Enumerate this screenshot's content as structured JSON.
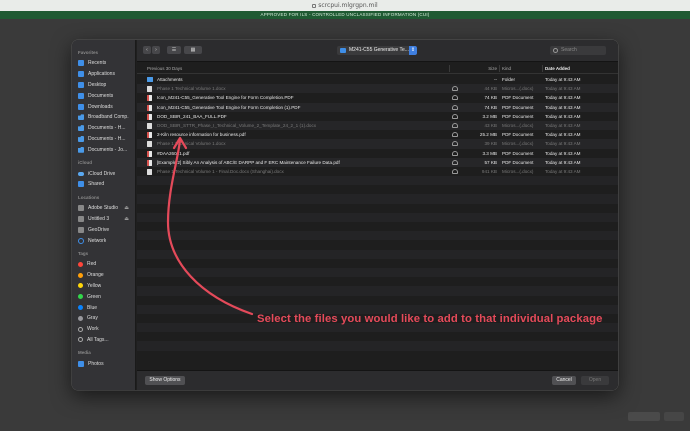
{
  "browser": {
    "url": "scrcpui.mlgrgpn.mil",
    "banner": "APPROVED FOR ILS - CONTROLLED UNCLASSIFIED INFORMATION (CUI)"
  },
  "sidebar": {
    "favorites_heading": "Favorites",
    "favorites": [
      {
        "label": "Recents",
        "icon": "clock-icon"
      },
      {
        "label": "Applications",
        "icon": "applications-icon"
      },
      {
        "label": "Desktop",
        "icon": "desktop-icon"
      },
      {
        "label": "Documents",
        "icon": "documents-icon"
      },
      {
        "label": "Downloads",
        "icon": "downloads-icon"
      },
      {
        "label": "Broadband Comp...",
        "icon": "folder-icon"
      },
      {
        "label": "Documents - H...",
        "icon": "folder-icon"
      },
      {
        "label": "Documents - H...",
        "icon": "folder-icon"
      },
      {
        "label": "Documents - Jo...",
        "icon": "folder-icon"
      }
    ],
    "icloud_heading": "iCloud",
    "icloud": [
      {
        "label": "iCloud Drive",
        "icon": "cloud-icon"
      },
      {
        "label": "Shared",
        "icon": "shared-icon"
      }
    ],
    "locations_heading": "Locations",
    "locations": [
      {
        "label": "Adobe Studio",
        "icon": "disk-icon"
      },
      {
        "label": "Untitled 3",
        "icon": "disk-icon"
      },
      {
        "label": "GeoDrive",
        "icon": "disk-icon"
      },
      {
        "label": "Network",
        "icon": "globe-icon"
      }
    ],
    "tags_heading": "Tags",
    "tags": [
      {
        "label": "Red",
        "color": "#ff453a"
      },
      {
        "label": "Orange",
        "color": "#ff9f0a"
      },
      {
        "label": "Yellow",
        "color": "#ffd60a"
      },
      {
        "label": "Green",
        "color": "#32d74b"
      },
      {
        "label": "Blue",
        "color": "#0a84ff"
      },
      {
        "label": "Gray",
        "color": "#98989d"
      },
      {
        "label": "Work",
        "color": ""
      },
      {
        "label": "All Tags...",
        "color": ""
      }
    ],
    "media_heading": "Media",
    "media": [
      {
        "label": "Photos",
        "icon": "photos-icon"
      }
    ]
  },
  "toolbar": {
    "back": "‹",
    "forward": "›",
    "view": "☰",
    "group": "▦",
    "location": "M241-C55 Generative Te...",
    "search_placeholder": "Search"
  },
  "columns": {
    "section": "Previous 30 Days",
    "size": "Size",
    "kind": "Kind",
    "date": "Date Added"
  },
  "files": [
    {
      "name": "Attachments",
      "type": "folder",
      "size": "--",
      "kind": "Folder",
      "date": "Today at 9:43 AM",
      "dim": false
    },
    {
      "name": "Phase 1 Technical Volume 1.docx",
      "type": "doc",
      "size": "44 KB",
      "kind": "Micros...(.docx)",
      "date": "Today at 9:43 AM",
      "dim": true
    },
    {
      "name": "Icon_M241-C55_Generative Tool Engine for Form Completion.PDF",
      "type": "pdf",
      "size": "74 KB",
      "kind": "PDF Document",
      "date": "Today at 9:43 AM",
      "dim": false
    },
    {
      "name": "Icon_M241-C55_Generative Tool Engine for Form Completion (1).PDF",
      "type": "pdf",
      "size": "74 KB",
      "kind": "PDF Document",
      "date": "Today at 9:43 AM",
      "dim": false
    },
    {
      "name": "DOD_SBIR_241_BAA_FULL.PDF",
      "type": "pdf",
      "size": "3.2 MB",
      "kind": "PDF Document",
      "date": "Today at 9:43 AM",
      "dim": false
    },
    {
      "name": "DOD_SBIR_STTR_Phase_I_Technical_Volume_2_Template_24_2_1 (1).docx",
      "type": "doc",
      "size": "43 KB",
      "kind": "Micros...(.docx)",
      "date": "Today at 9:43 AM",
      "dim": true
    },
    {
      "name": "2-Kiln resource information for business.pdf",
      "type": "pdf",
      "size": "25.2 MB",
      "kind": "PDF Document",
      "date": "Today at 9:43 AM",
      "dim": false
    },
    {
      "name": "Phase 1 Technical Volume 1.docx",
      "type": "doc",
      "size": "39 KB",
      "kind": "Micros...(.docx)",
      "date": "Today at 9:43 AM",
      "dim": true
    },
    {
      "name": "#DAA26041.pdf",
      "type": "pdf",
      "size": "3.3 MB",
      "kind": "PDF Document",
      "date": "Today at 9:43 AM",
      "dim": false
    },
    {
      "name": "[Example 2] Sibly An Analysis of ABC/E DARPP and F ERC Maintenance Failure Data.pdf",
      "type": "pdf",
      "size": "57 KB",
      "kind": "PDF Document",
      "date": "Today at 9:43 AM",
      "dim": false
    },
    {
      "name": "Phase 1 Technical Volume 1 - Final.Doc.docx (Shanghai).docx",
      "type": "doc",
      "size": "941 KB",
      "kind": "Micros...(.docx)",
      "date": "Today at 9:43 AM",
      "dim": true
    }
  ],
  "annotation": "Select the files you would like to add to that individual package",
  "footer": {
    "show_options": "Show Options",
    "cancel": "Cancel",
    "open": "Open"
  }
}
